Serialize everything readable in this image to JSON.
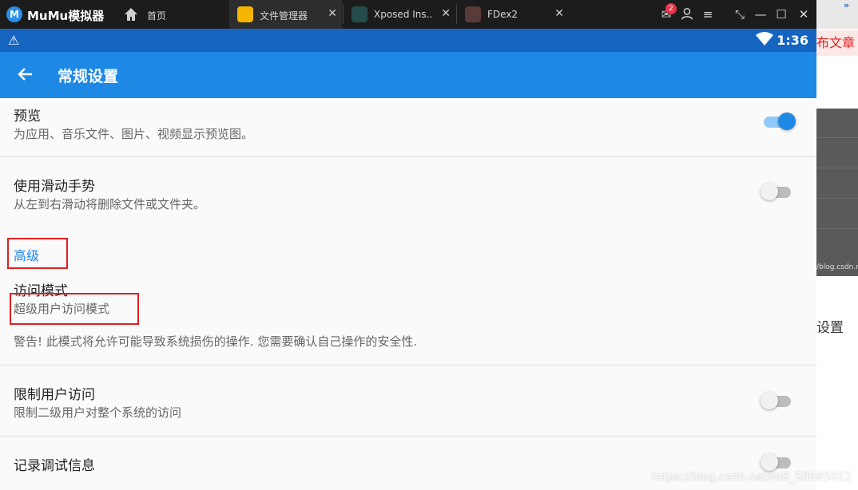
{
  "emulator": {
    "brand": "MuMu模拟器",
    "tabs": [
      {
        "label": "首页",
        "icon": "home-icon"
      },
      {
        "label": "文件管理器",
        "icon": "file-manager-icon"
      },
      {
        "label": "Xposed Ins..",
        "icon": "xposed-icon"
      },
      {
        "label": "FDex2",
        "icon": "fdex2-icon"
      }
    ],
    "notification_count": "2",
    "controls": [
      "mail-icon",
      "user-icon",
      "menu-icon",
      "shrink-icon",
      "minimize-icon",
      "maximize-icon",
      "close-icon"
    ]
  },
  "status_bar": {
    "time": "1:36"
  },
  "app_bar": {
    "title": "常规设置"
  },
  "settings": {
    "preview": {
      "title": "预览",
      "subtitle": "为应用、音乐文件、图片、视频显示预览图。",
      "enabled": true
    },
    "swipe": {
      "title": "使用滑动手势",
      "subtitle": "从左到右滑动将删除文件或文件夹。",
      "enabled": false
    },
    "advanced_section": "高级",
    "access_mode": {
      "title": "访问模式",
      "value": "超级用户访问模式",
      "warning": "警告! 此模式将允许可能导致系统损伤的操作. 您需要确认自己操作的安全性."
    },
    "restrict_access": {
      "title": "限制用户访问",
      "subtitle": "限制二级用户对整个系统的访问",
      "enabled": false
    },
    "debug_log": {
      "title": "记录调试信息",
      "enabled": false
    }
  },
  "background_window": {
    "publish_text": "布文章",
    "url_fragment": "/blog.csdn.ne",
    "setting_text": "设置",
    "chevron": "»"
  },
  "watermark": "https://blog.csdn.net/m0_50685012",
  "colors": {
    "accent": "#1e88e5",
    "status_bar": "#1565c0",
    "highlight_box": "#e02020"
  }
}
